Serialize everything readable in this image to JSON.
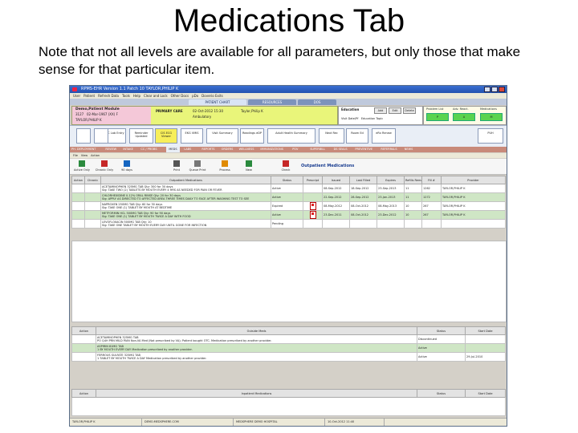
{
  "slide": {
    "title": "Medications Tab",
    "note": "Note that not all levels are available for all parameters, but only those that make sense for that particular item."
  },
  "window": {
    "title": "RPMS-EHR  Version 1.1 Patch 10  TAYLOR,PHILIP K",
    "menus": [
      "User",
      "Patient",
      "Refresh Data",
      "Tools",
      "Help",
      "Clear and Lock",
      "Other Docs",
      "pDo",
      "Doverio Exits"
    ]
  },
  "top_tabs": [
    "PATIENT CHART",
    "RESOURCES",
    "DOS"
  ],
  "patient": {
    "name": "Demo,Patient Module",
    "id": "3127",
    "dob": "02-Mar-1967 (XX) F",
    "provider": "TAYLOR,PHILIP K",
    "clinic": "PRIMARY CARE",
    "visit_date": "02-Oct-2012 15:30",
    "visit_type": "Ambulatory",
    "visit_provider": "Taylor,Philip K"
  },
  "education": {
    "label": "Education",
    "buttons": [
      "Add",
      "Edit",
      "Delete"
    ],
    "sub_left": "Visit Date/Pf",
    "sub_right": "Education Topic"
  },
  "problem_panel": {
    "headers": [
      "Problem List",
      "Adv. React.",
      "Medications"
    ],
    "pills": [
      "P",
      "A",
      "M"
    ]
  },
  "toolbar_buttons": [
    "POC Lab Entry",
    "Reminder Updated",
    "CIS ECG Viewer",
    "EKG VMIS",
    "Visit Summary",
    "Readings eDP",
    "Adult Health Summary",
    "Next Rec",
    "Room Ed",
    "eRx Renew",
    "PUH"
  ],
  "nav_tabs": [
    "PH. DEPLOYMENT",
    "REVIEW",
    "INTAKE",
    "CC / PROBS",
    "MEDS",
    "LABS",
    "REPORTS",
    "ORDERS",
    "WELLNESS",
    "IMMUNIZATIONS",
    "POV",
    "SUPERBILL",
    "DS SEALS",
    "PREVENTIVE",
    "REFERRALS",
    "NEWS"
  ],
  "active_nav_tab": "MEDS",
  "sub_menu": [
    "File",
    "View",
    "Action"
  ],
  "meds_toolbar": [
    "Active Only",
    "Chronic Only",
    "90 days",
    "Print",
    "Queue Print",
    "Process",
    "New",
    "Check"
  ],
  "outpatient_title": "Outpatient Medications",
  "outpatient_columns": [
    "Action",
    "Chronic",
    "Outpatient Medications",
    "Status",
    "Prescript",
    "Issued",
    "Last Filled",
    "Expires",
    "Refills Remaining",
    "Fill #",
    "Provider"
  ],
  "outpatient_rows": [
    {
      "style": "g-white",
      "action": "",
      "chronic": "",
      "med": "ACETAMINOPHEN 325MG TAB  Qty: 300 for 30 days",
      "sig": "Sig: TAKE TWO (2) TABLETS BY MOUTH EVERY 4 HRS AS NEEDED FOR PAIN OR FEVER",
      "status": "Active",
      "rx": "",
      "issued": "08-Sep-2012",
      "filled": "18-Sep-2012",
      "expires": "23-Sep-2013",
      "refills": "11",
      "fill": "1262",
      "provider": "TAYLOR,PHILIP K"
    },
    {
      "style": "g-green",
      "action": "",
      "chronic": "",
      "med": "CHLORHEXIDINE 0.12% ORAL RINSE  Qty: 20 for 30 days",
      "sig": "Sig: APPLY AS DIRECTED TO AFFECTED AREA THREE TIMES DAILY TO FACE AFTER WASHING  TEST TO SEE",
      "status": "Active",
      "rx": "",
      "issued": "22-Sep-2012",
      "filled": "28-Sep-2012",
      "expires": "23-Jan-2013",
      "refills": "11",
      "fill": "1272",
      "provider": "TAYLOR,PHILIP K"
    },
    {
      "style": "g-white",
      "action": "",
      "chronic": "",
      "med": "NAPROXEN 250MG TAB  Qty: 60 for 30 days",
      "sig": "Sig: TAKE ONE (1) TABLET BY MOUTH AT BEDTIME",
      "status": "Expired",
      "rx": "icon",
      "issued": "08-May-2012",
      "filled": "08-Oct-2012",
      "expires": "08-May-2013",
      "refills": "10",
      "fill": "267",
      "provider": "TAYLOR,PHILIP K"
    },
    {
      "style": "g-green",
      "action": "",
      "chronic": "",
      "med": "METFORMIN HCL 500MG TAB  Qty: 90 for 90 days",
      "sig": "Sig: TAKE ONE (1) TABLET BY MOUTH TWICE A DAY WITH FOOD",
      "status": "Active",
      "rx": "icon",
      "issued": "23-Dec-2011",
      "filled": "08-Oct-2012",
      "expires": "23-Dec-2012",
      "refills": "10",
      "fill": "267",
      "provider": "TAYLOR,PHILIP K"
    },
    {
      "style": "g-white",
      "action": "",
      "chronic": "",
      "med": "LEVOFLOXACIN 500MG TAB  Qty: 10",
      "sig": "Sig: TAKE ONE TABLET BY MOUTH EVERY DAY UNTIL GONE FOR INFECTION",
      "status": "Pending",
      "rx": "",
      "issued": "",
      "filled": "",
      "expires": "",
      "refills": "",
      "fill": "",
      "provider": ""
    }
  ],
  "nonva_columns": [
    "Action",
    "Outside Meds",
    "Status",
    "Start Date"
  ],
  "nonva_rows": [
    {
      "style": "g-white",
      "action": "",
      "med": "ACETAMINOPHEN 325MG TAB",
      "sig": "PO Q4H PRN MILD PAIN Non-VA Med (Not prescribed by VA); Patient bought OTC. Medication prescribed by another provider.",
      "status": "Discontinued",
      "start": ""
    },
    {
      "style": "g-green",
      "action": "",
      "med": "ASPIRIN 81MG TAB",
      "sig": "1 BY MOUTH EVERY DAY Medication prescribed by another provider.",
      "status": "Active",
      "start": ""
    },
    {
      "style": "g-white",
      "action": "",
      "med": "FERROUS SULFATE 325MG TAB",
      "sig": "1 TABLET BY MOUTH TWICE A DAY Medication prescribed by another provider.",
      "status": "Active",
      "start": "29-Jul-2010"
    }
  ],
  "inpatient_columns": [
    "Action",
    "Inpatient Medications",
    "Status",
    "Start Date"
  ],
  "status_bar": [
    "TAYLOR,PHILIP K",
    "DEMO.MEDSPHERE.COM",
    "MEDSPHERE DEMO HOSPITAL",
    "10-Oct-2012 11:40"
  ]
}
